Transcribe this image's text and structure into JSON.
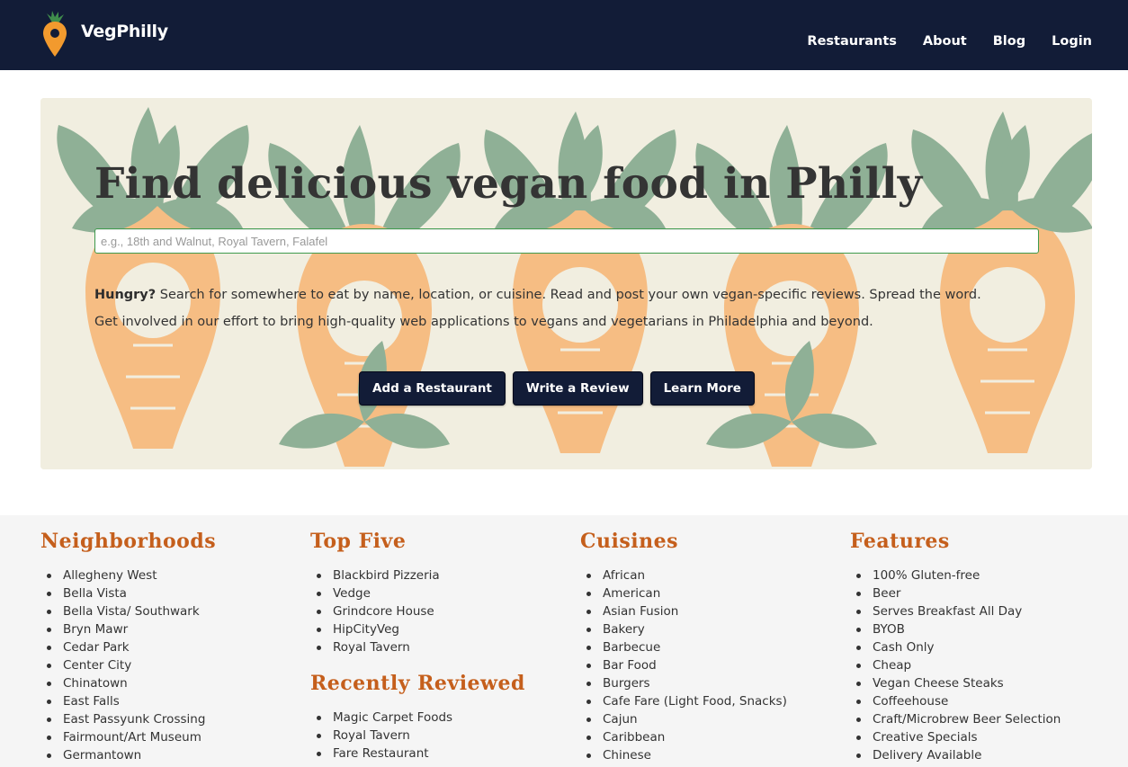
{
  "brand": {
    "name": "VegPhilly",
    "icon": "map-pin-carrot-icon"
  },
  "nav": [
    "Restaurants",
    "About",
    "Blog",
    "Login"
  ],
  "hero": {
    "title": "Find delicious vegan food in Philly",
    "search_placeholder": "e.g., 18th and Walnut, Royal Tavern, Falafel",
    "intro_bold": "Hungry?",
    "intro_text": " Search for somewhere to eat by name, location, or cuisine. Read and post your own vegan-specific reviews. Spread the word.",
    "intro_text2": "Get involved in our effort to bring high-quality web applications to vegans and vegetarians in Philadelphia and beyond.",
    "buttons": [
      "Add a Restaurant",
      "Write a Review",
      "Learn More"
    ]
  },
  "sections": {
    "neighborhoods": {
      "title": "Neighborhoods",
      "items": [
        "Allegheny West",
        "Bella Vista",
        "Bella Vista/ Southwark",
        "Bryn Mawr",
        "Cedar Park",
        "Center City",
        "Chinatown",
        "East Falls",
        "East Passyunk Crossing",
        "Fairmount/Art Museum",
        "Germantown"
      ]
    },
    "top_five": {
      "title": "Top Five",
      "items": [
        "Blackbird Pizzeria",
        "Vedge",
        "Grindcore House",
        "HipCityVeg",
        "Royal Tavern"
      ]
    },
    "recently_reviewed": {
      "title": "Recently Reviewed",
      "items": [
        "Magic Carpet Foods",
        "Royal Tavern",
        "Fare Restaurant"
      ]
    },
    "cuisines": {
      "title": "Cuisines",
      "items": [
        "African",
        "American",
        "Asian Fusion",
        "Bakery",
        "Barbecue",
        "Bar Food",
        "Burgers",
        "Cafe Fare (Light Food, Snacks)",
        "Cajun",
        "Caribbean",
        "Chinese"
      ]
    },
    "features": {
      "title": "Features",
      "items": [
        "100% Gluten-free",
        "Beer",
        "Serves Breakfast All Day",
        "BYOB",
        "Cash Only",
        "Cheap",
        "Vegan Cheese Steaks",
        "Coffeehouse",
        "Craft/Microbrew Beer Selection",
        "Creative Specials",
        "Delivery Available"
      ]
    }
  },
  "colors": {
    "navbar": "#121c37",
    "accent": "#c55f1c",
    "carrot": "#f6bd83",
    "leaf": "#8fb096",
    "hero_bg": "#f1eee0"
  }
}
